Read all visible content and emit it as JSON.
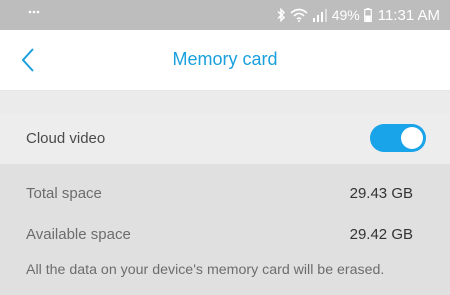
{
  "status_bar": {
    "battery": "49%",
    "time": "11:31 AM"
  },
  "header": {
    "title": "Memory card"
  },
  "cloud_video": {
    "label": "Cloud video",
    "enabled": true
  },
  "storage": {
    "total_label": "Total space",
    "total_value": "29.43 GB",
    "available_label": "Available space",
    "available_value": "29.42 GB",
    "note": "All the data on your device's memory card will be erased."
  },
  "colors": {
    "accent": "#1aa0dd",
    "toggle_on": "#19a3e8",
    "status_bar": "#bdbdbd"
  }
}
